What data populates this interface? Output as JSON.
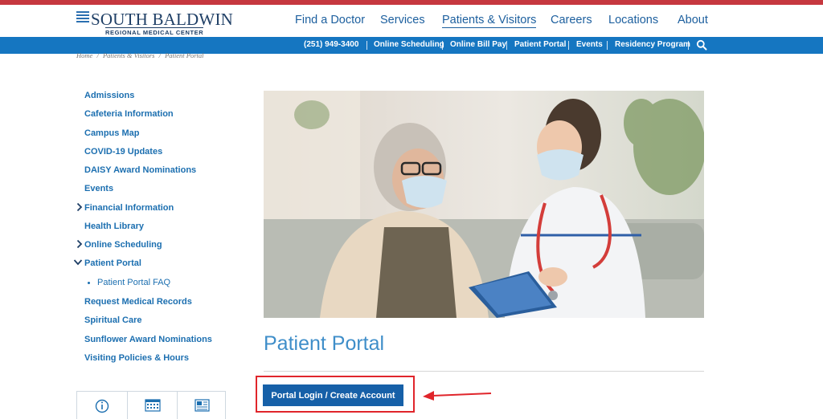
{
  "header": {
    "logo_main": "SOUTH BALDWIN",
    "logo_sub": "REGIONAL MEDICAL CENTER",
    "nav": [
      {
        "label": "Find a Doctor"
      },
      {
        "label": "Services"
      },
      {
        "label": "Patients & Visitors"
      },
      {
        "label": "Careers"
      },
      {
        "label": "Locations"
      },
      {
        "label": "About"
      }
    ]
  },
  "util_bar": {
    "items": [
      {
        "label": "(251) 949-3400"
      },
      {
        "label": "Online Scheduling"
      },
      {
        "label": "Online Bill Pay"
      },
      {
        "label": "Patient Portal"
      },
      {
        "label": "Events"
      },
      {
        "label": "Residency Program"
      }
    ]
  },
  "breadcrumb": [
    "Home",
    "/",
    "Patients & Visitors",
    "/",
    "Patient Portal"
  ],
  "sidebar": {
    "items": [
      {
        "label": "Admissions"
      },
      {
        "label": "Cafeteria Information"
      },
      {
        "label": "Campus Map"
      },
      {
        "label": "COVID-19 Updates"
      },
      {
        "label": "DAISY Award Nominations"
      },
      {
        "label": "Events"
      },
      {
        "label": "Financial Information"
      },
      {
        "label": "Health Library"
      },
      {
        "label": "Online Scheduling"
      },
      {
        "label": "Patient Portal"
      },
      {
        "label": "Patient Portal FAQ"
      },
      {
        "label": "Request Medical Records"
      },
      {
        "label": "Spiritual Care"
      },
      {
        "label": "Sunflower Award Nominations"
      },
      {
        "label": "Visiting Policies & Hours"
      }
    ]
  },
  "main": {
    "title": "Patient Portal",
    "button_label": "Portal Login / Create Account"
  },
  "colors": {
    "accent": "#1576c1",
    "top_stripe": "#c6383f",
    "highlight": "#e0252b",
    "button": "#1660a8"
  }
}
